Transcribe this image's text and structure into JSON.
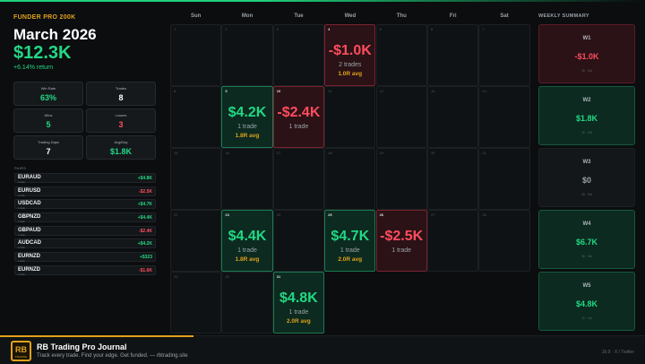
{
  "account": "FUNDER PRO 200K",
  "month_title": "March 2026",
  "total_pl": "$12.3K",
  "return_text": "+6.14% return",
  "stats": [
    {
      "label": "Win Rate",
      "value": "63%",
      "tone": "pos"
    },
    {
      "label": "Trades",
      "value": "8",
      "tone": "white"
    },
    {
      "label": "Wins",
      "value": "5",
      "tone": "pos"
    },
    {
      "label": "Losses",
      "value": "3",
      "tone": "neg"
    },
    {
      "label": "Trading Days",
      "value": "7",
      "tone": "white"
    },
    {
      "label": "Avg/Day",
      "value": "$1.8K",
      "tone": "pos"
    }
  ],
  "pairs_header": "PAIRS",
  "pairs": [
    {
      "name": "EURAUD",
      "sub": "1 trade",
      "value": "+$4.8K",
      "tone": "pos"
    },
    {
      "name": "EURUSD",
      "sub": "1 trade",
      "value": "-$2.5K",
      "tone": "neg"
    },
    {
      "name": "USDCAD",
      "sub": "1 trade",
      "value": "+$4.7K",
      "tone": "pos"
    },
    {
      "name": "GBPNZD",
      "sub": "1 trade",
      "value": "+$4.4K",
      "tone": "pos"
    },
    {
      "name": "GBPAUD",
      "sub": "1 trade",
      "value": "-$2.4K",
      "tone": "neg"
    },
    {
      "name": "AUDCAD",
      "sub": "1 trade",
      "value": "+$4.2K",
      "tone": "pos"
    },
    {
      "name": "EURNZD",
      "sub": "1 trade",
      "value": "+$323",
      "tone": "pos"
    },
    {
      "name": "EURNZD",
      "sub": "1 trade",
      "value": "-$1.6K",
      "tone": "neg"
    }
  ],
  "weekdays": [
    "Sun",
    "Mon",
    "Tue",
    "Wed",
    "Thu",
    "Fri",
    "Sat"
  ],
  "calendar": [
    [
      {
        "day": "1",
        "type": "empty"
      },
      {
        "day": "2",
        "type": "empty"
      },
      {
        "day": "3",
        "type": "empty"
      },
      {
        "day": "4",
        "type": "loss",
        "pl": "-$1.0K",
        "trades": "2 trades",
        "avg": "1.0R avg"
      },
      {
        "day": "5",
        "type": "empty"
      },
      {
        "day": "6",
        "type": "empty"
      },
      {
        "day": "7",
        "type": "empty"
      }
    ],
    [
      {
        "day": "8",
        "type": "empty"
      },
      {
        "day": "9",
        "type": "win",
        "pl": "$4.2K",
        "trades": "1 trade",
        "avg": "1.8R avg"
      },
      {
        "day": "10",
        "type": "loss",
        "pl": "-$2.4K",
        "trades": "1 trade",
        "avg": ""
      },
      {
        "day": "11",
        "type": "empty"
      },
      {
        "day": "12",
        "type": "empty"
      },
      {
        "day": "13",
        "type": "empty"
      },
      {
        "day": "14",
        "type": "empty"
      }
    ],
    [
      {
        "day": "15",
        "type": "empty"
      },
      {
        "day": "16",
        "type": "empty"
      },
      {
        "day": "17",
        "type": "empty"
      },
      {
        "day": "18",
        "type": "empty"
      },
      {
        "day": "19",
        "type": "empty"
      },
      {
        "day": "20",
        "type": "empty"
      },
      {
        "day": "21",
        "type": "empty"
      }
    ],
    [
      {
        "day": "22",
        "type": "empty"
      },
      {
        "day": "23",
        "type": "win",
        "pl": "$4.4K",
        "trades": "1 trade",
        "avg": "1.8R avg"
      },
      {
        "day": "24",
        "type": "empty"
      },
      {
        "day": "25",
        "type": "win",
        "pl": "$4.7K",
        "trades": "1 trade",
        "avg": "2.0R avg"
      },
      {
        "day": "26",
        "type": "loss",
        "pl": "-$2.5K",
        "trades": "1 trade",
        "avg": ""
      },
      {
        "day": "27",
        "type": "empty"
      },
      {
        "day": "28",
        "type": "empty"
      }
    ],
    [
      {
        "day": "29",
        "type": "empty"
      },
      {
        "day": "30",
        "type": "empty"
      },
      {
        "day": "31",
        "type": "win",
        "pl": "$4.8K",
        "trades": "1 trade",
        "avg": "2.0R avg"
      },
      {
        "day": "",
        "type": "blank"
      },
      {
        "day": "",
        "type": "blank"
      },
      {
        "day": "",
        "type": "blank"
      },
      {
        "day": "",
        "type": "blank"
      }
    ]
  ],
  "weekly_header": "WEEKLY SUMMARY",
  "weeks": [
    {
      "label": "W1",
      "value": "-$1.0K",
      "sub": "2t · 0d",
      "tone": "neg"
    },
    {
      "label": "W2",
      "value": "$1.8K",
      "sub": "2t · 2d",
      "tone": "pos"
    },
    {
      "label": "W3",
      "value": "$0",
      "sub": "0t · 0d",
      "tone": "neu"
    },
    {
      "label": "W4",
      "value": "$6.7K",
      "sub": "3t · 3d",
      "tone": "pos"
    },
    {
      "label": "W5",
      "value": "$4.8K",
      "sub": "1t · 1d",
      "tone": "pos"
    }
  ],
  "footer": {
    "logo_text": "RB",
    "logo_sub": "TRADING",
    "name": "RB Trading Pro Journal",
    "tagline": "Track every trade. Find your edge. Get funded.  —  rbtrading.site",
    "right": "16:9  ·  X / Twitter"
  }
}
